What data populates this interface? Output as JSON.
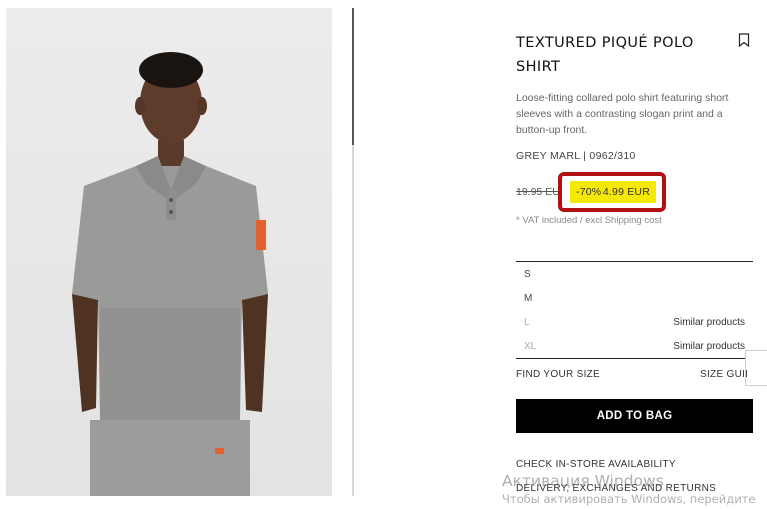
{
  "product": {
    "title": "TEXTURED PIQUÉ POLO SHIRT",
    "description": "Loose-fitting collared polo shirt featuring short sleeves with a contrasting slogan print and a button-up front.",
    "color_ref": "GREY MARL | 0962/310",
    "old_price": "19.95 EU",
    "discount": "-70%",
    "price": "4.99 EUR",
    "vat_note": "* VAT included / excl Shipping cost",
    "bookmark_icon": "bookmark-icon"
  },
  "sizes": [
    {
      "label": "S",
      "available": true,
      "note": ""
    },
    {
      "label": "M",
      "available": true,
      "note": ""
    },
    {
      "label": "L",
      "available": false,
      "note": "Similar products"
    },
    {
      "label": "XL",
      "available": false,
      "note": "Similar products"
    }
  ],
  "actions": {
    "find_size": "FIND YOUR SIZE",
    "size_guide": "SIZE GUIDE",
    "add_to_bag": "ADD TO BAG",
    "check_store": "CHECK IN-STORE AVAILABILITY",
    "delivery": "DELIVERY, EXCHANGES AND RETURNS"
  },
  "watermark": {
    "line1": "Активация Windows",
    "line2": "Чтобы активировать Windows, перейдите"
  },
  "colors": {
    "price_highlight": "#f4e804",
    "annotation_border": "#b01010",
    "button_bg": "#000000"
  }
}
